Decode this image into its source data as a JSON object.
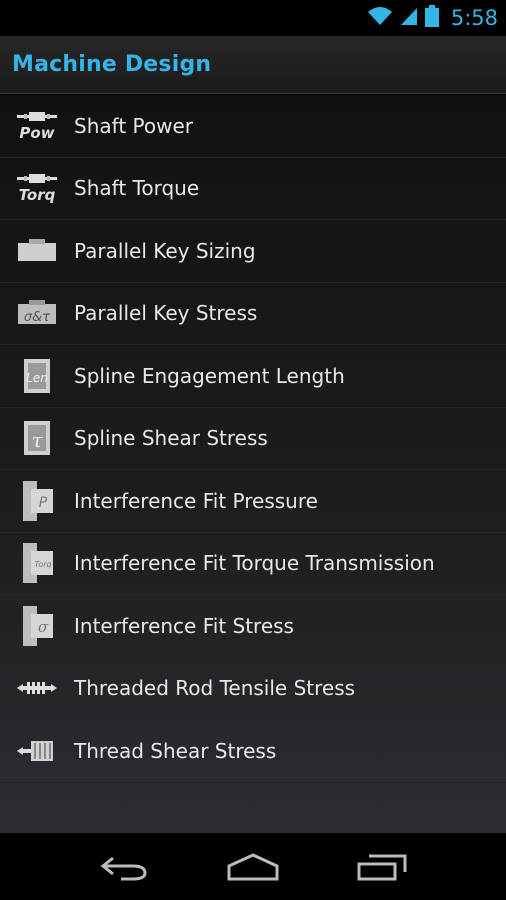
{
  "status": {
    "time": "5:58"
  },
  "app": {
    "title": "Machine Design"
  },
  "items": [
    {
      "label": "Shaft Power",
      "icon": "shaft-power-icon",
      "icon_text": "Pow"
    },
    {
      "label": "Shaft Torque",
      "icon": "shaft-torque-icon",
      "icon_text": "Torq"
    },
    {
      "label": "Parallel Key Sizing",
      "icon": "parallel-key-icon",
      "icon_text": ""
    },
    {
      "label": "Parallel Key Stress",
      "icon": "parallel-key-stress-icon",
      "icon_text": "σ&τ"
    },
    {
      "label": "Spline Engagement Length",
      "icon": "spline-length-icon",
      "icon_text": "Len"
    },
    {
      "label": "Spline Shear Stress",
      "icon": "spline-shear-icon",
      "icon_text": "τ"
    },
    {
      "label": "Interference Fit Pressure",
      "icon": "interference-pressure-icon",
      "icon_text": "P"
    },
    {
      "label": "Interference Fit Torque Transmission",
      "icon": "interference-torque-icon",
      "icon_text": "Torq"
    },
    {
      "label": "Interference Fit Stress",
      "icon": "interference-stress-icon",
      "icon_text": "σ"
    },
    {
      "label": "Threaded Rod Tensile Stress",
      "icon": "threaded-rod-icon",
      "icon_text": ""
    },
    {
      "label": "Thread Shear Stress",
      "icon": "thread-shear-icon",
      "icon_text": ""
    }
  ],
  "colors": {
    "accent": "#33b5e5",
    "text": "#e8e8e8"
  }
}
